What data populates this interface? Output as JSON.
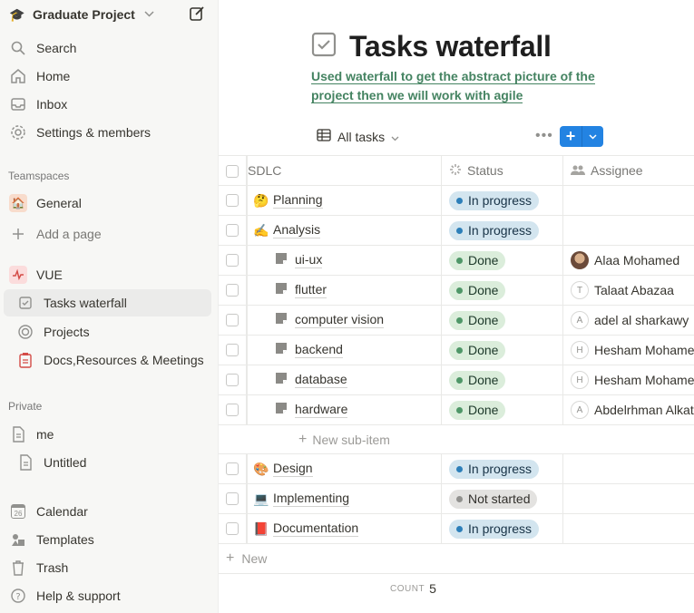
{
  "workspace": {
    "name": "Graduate Project"
  },
  "nav": {
    "search": "Search",
    "home": "Home",
    "inbox": "Inbox",
    "settings": "Settings & members"
  },
  "teamspaces": {
    "heading": "Teamspaces",
    "general": "General",
    "add_page": "Add a page",
    "vue": "VUE",
    "tasks_waterfall": "Tasks waterfall",
    "projects": "Projects",
    "docs": "Docs,Resources & Meetings"
  },
  "private": {
    "heading": "Private",
    "me": "me",
    "untitled": "Untitled"
  },
  "bottom_nav": {
    "calendar": "Calendar",
    "calendar_day": "26",
    "templates": "Templates",
    "trash": "Trash",
    "help": "Help & support"
  },
  "page": {
    "title": "Tasks waterfall",
    "description": "Used waterfall to get the abstract picture of the project then we will work with agile",
    "view_name": "All tasks"
  },
  "table": {
    "columns": {
      "name": "SDLC",
      "status": "Status",
      "assignee": "Assignee"
    },
    "rows": [
      {
        "name": "Planning",
        "emoji": "🤔",
        "status": "In progress",
        "assignee": ""
      },
      {
        "name": "Analysis",
        "emoji": "✍️",
        "status": "In progress",
        "assignee": ""
      },
      {
        "name": "ui-ux",
        "sub": true,
        "status": "Done",
        "assignee": "Alaa Mohamed",
        "initial": ""
      },
      {
        "name": "flutter",
        "sub": true,
        "status": "Done",
        "assignee": "Talaat Abazaa",
        "initial": "T"
      },
      {
        "name": "computer vision",
        "sub": true,
        "status": "Done",
        "assignee": "adel al sharkawy",
        "initial": "A"
      },
      {
        "name": "backend",
        "sub": true,
        "status": "Done",
        "assignee": "Hesham Mohame",
        "initial": "H"
      },
      {
        "name": "database",
        "sub": true,
        "status": "Done",
        "assignee": "Hesham Mohame",
        "initial": "H"
      },
      {
        "name": "hardware",
        "sub": true,
        "status": "Done",
        "assignee": "Abdelrhman Alkat",
        "initial": "A"
      }
    ],
    "new_subitem": "New sub-item",
    "rows2": [
      {
        "name": "Design",
        "emoji": "🎨",
        "status": "In progress",
        "assignee": ""
      },
      {
        "name": "Implementing",
        "emoji": "💻",
        "status": "Not started",
        "assignee": ""
      },
      {
        "name": "Documentation",
        "emoji": "📕",
        "status": "In progress",
        "assignee": ""
      }
    ],
    "new_row": "New",
    "count_label": "COUNT",
    "count_value": "5"
  },
  "colors": {
    "accent": "#2383e2",
    "description_green": "#448361",
    "in_progress_bg": "#d3e5ef",
    "done_bg": "#dbeddb",
    "not_started_bg": "#e3e2e0"
  }
}
